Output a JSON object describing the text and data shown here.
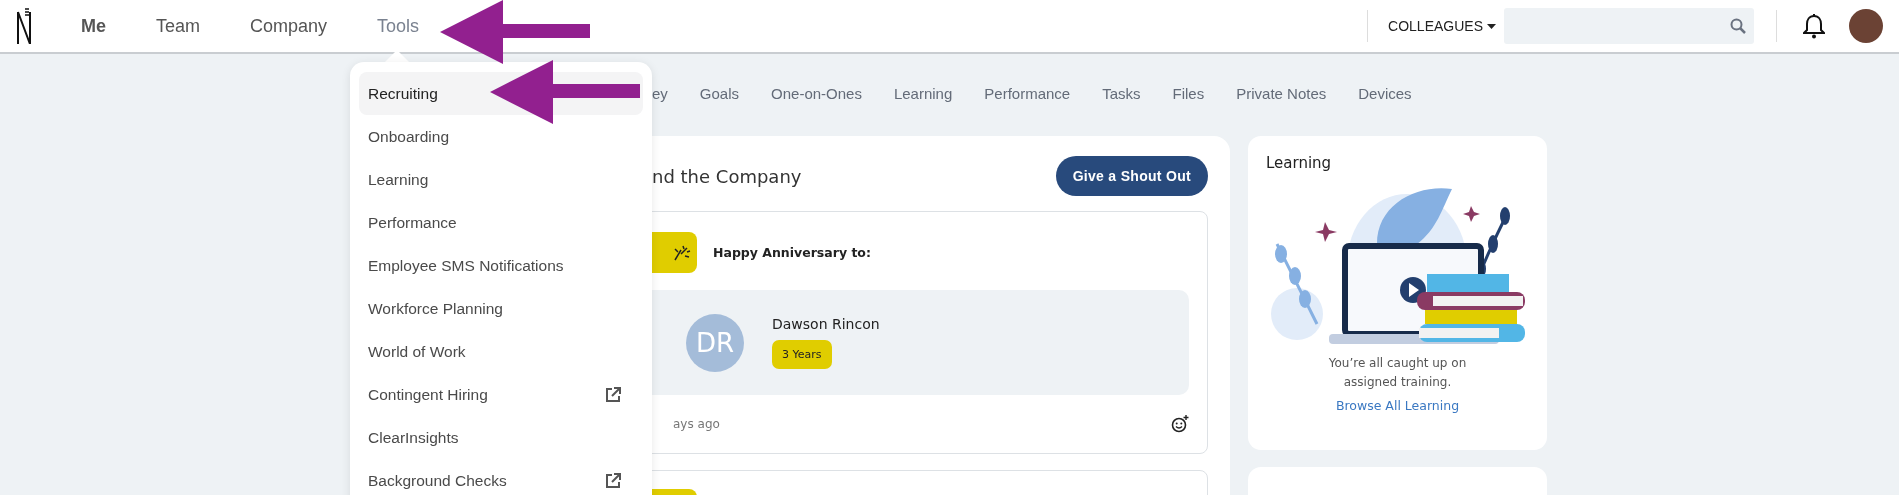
{
  "nav": {
    "items": [
      {
        "label": "Me",
        "selected": true,
        "expanded": false
      },
      {
        "label": "Team",
        "selected": false,
        "expanded": false
      },
      {
        "label": "Company",
        "selected": false,
        "expanded": false
      },
      {
        "label": "Tools",
        "selected": false,
        "expanded": true
      }
    ]
  },
  "scope_dropdown": {
    "label": "COLLEAGUES"
  },
  "tools_menu": {
    "items": [
      {
        "label": "Recruiting",
        "selected": true,
        "external": false
      },
      {
        "label": "Onboarding",
        "selected": false,
        "external": false
      },
      {
        "label": "Learning",
        "selected": false,
        "external": false
      },
      {
        "label": "Performance",
        "selected": false,
        "external": false
      },
      {
        "label": "Employee SMS Notifications",
        "selected": false,
        "external": false
      },
      {
        "label": "Workforce Planning",
        "selected": false,
        "external": false
      },
      {
        "label": "World of Work",
        "selected": false,
        "external": false
      },
      {
        "label": "Contingent Hiring",
        "selected": false,
        "external": true
      },
      {
        "label": "ClearInsights",
        "selected": false,
        "external": false
      },
      {
        "label": "Background Checks",
        "selected": false,
        "external": true
      }
    ]
  },
  "tabs": [
    {
      "label": "ey"
    },
    {
      "label": "Goals"
    },
    {
      "label": "One-on-Ones"
    },
    {
      "label": "Learning"
    },
    {
      "label": "Performance"
    },
    {
      "label": "Tasks"
    },
    {
      "label": "Files"
    },
    {
      "label": "Private Notes"
    },
    {
      "label": "Devices"
    }
  ],
  "feed": {
    "title": "nd the Company",
    "button": "Give a Shout Out",
    "posts": [
      {
        "heading": "Happy Anniversary to:",
        "initials": "DR",
        "name": "Dawson Rincon",
        "badge": "3 Years",
        "time": "ays ago"
      }
    ]
  },
  "learning": {
    "title": "Learning",
    "message": "You’re all caught up on assigned training.",
    "link": "Browse All Learning"
  }
}
